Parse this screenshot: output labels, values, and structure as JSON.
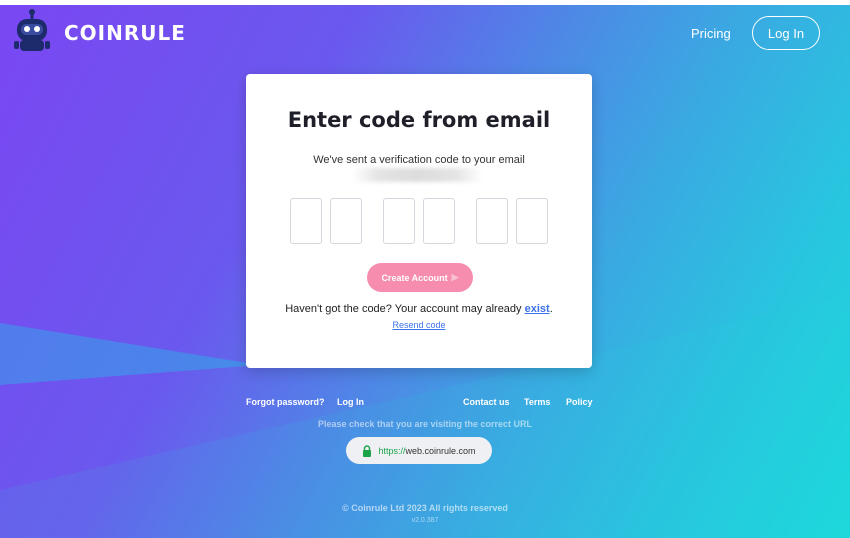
{
  "header": {
    "brand": "COINRULE",
    "pricing_label": "Pricing",
    "login_label": "Log In"
  },
  "card": {
    "title": "Enter code from email",
    "subtitle": "We've sent a verification code to your email",
    "code_values": [
      "",
      "",
      "",
      "",
      "",
      ""
    ],
    "create_button_label": "Create Account",
    "no_code_text": "Haven't got the code? Your account may already ",
    "exist_link": "exist",
    "exist_suffix": ".",
    "resend_label": "Resend code"
  },
  "footer": {
    "forgot_password": "Forgot password?",
    "login": "Log In",
    "contact": "Contact us",
    "terms": "Terms",
    "policy": "Policy",
    "check_url_text": "Please check that you are visiting the correct URL",
    "url_https": "https://",
    "url_domain": "web.coinrule.com",
    "copyright": "© Coinrule Ltd 2023 All rights reserved",
    "version": "v2.0.387"
  },
  "colors": {
    "gradient_purple": "#7a47f2",
    "gradient_teal": "#1cd9dc",
    "button_pink": "#f68cae",
    "link_blue": "#3d73e8",
    "lock_green": "#1ba34a"
  },
  "icons": {
    "logo": "robot-icon",
    "button_arrow": "play-arrow-icon",
    "url_lock": "lock-icon"
  }
}
